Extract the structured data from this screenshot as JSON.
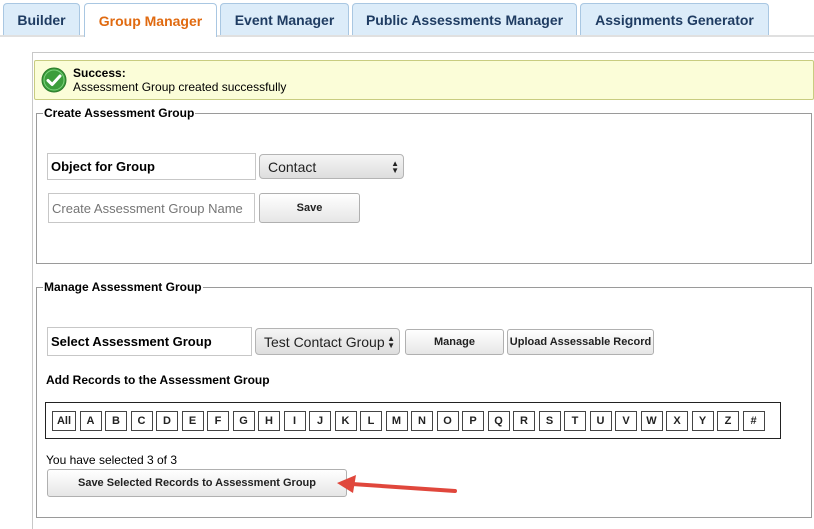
{
  "tabs": [
    {
      "label": "Builder",
      "active": false
    },
    {
      "label": "Group Manager",
      "active": true
    },
    {
      "label": "Event Manager",
      "active": false
    },
    {
      "label": "Public Assessments Manager",
      "active": false
    },
    {
      "label": "Assignments Generator",
      "active": false
    }
  ],
  "message": {
    "title": "Success:",
    "text": "Assessment Group created successfully",
    "icon": "check-circle-icon",
    "color": "#3c9d3c"
  },
  "create_group": {
    "legend": "Create Assessment Group",
    "object_label": "Object for Group",
    "object_value": "Contact",
    "name_placeholder": "Create Assessment Group Name",
    "save_label": "Save"
  },
  "manage_group": {
    "legend": "Manage Assessment Group",
    "select_label": "Select Assessment Group",
    "select_value": "Test Contact Group",
    "manage_label": "Manage",
    "upload_label": "Upload Assessable Record",
    "add_records_title": "Add Records to the Assessment Group",
    "letters": [
      "All",
      "A",
      "B",
      "C",
      "D",
      "E",
      "F",
      "G",
      "H",
      "I",
      "J",
      "K",
      "L",
      "M",
      "N",
      "O",
      "P",
      "Q",
      "R",
      "S",
      "T",
      "U",
      "V",
      "W",
      "X",
      "Y",
      "Z",
      "#"
    ],
    "selected_text": "You have selected 3 of 3",
    "save_selected_label": "Save Selected Records to Assessment Group"
  },
  "annotation": {
    "arrow_color": "#e0473c"
  }
}
